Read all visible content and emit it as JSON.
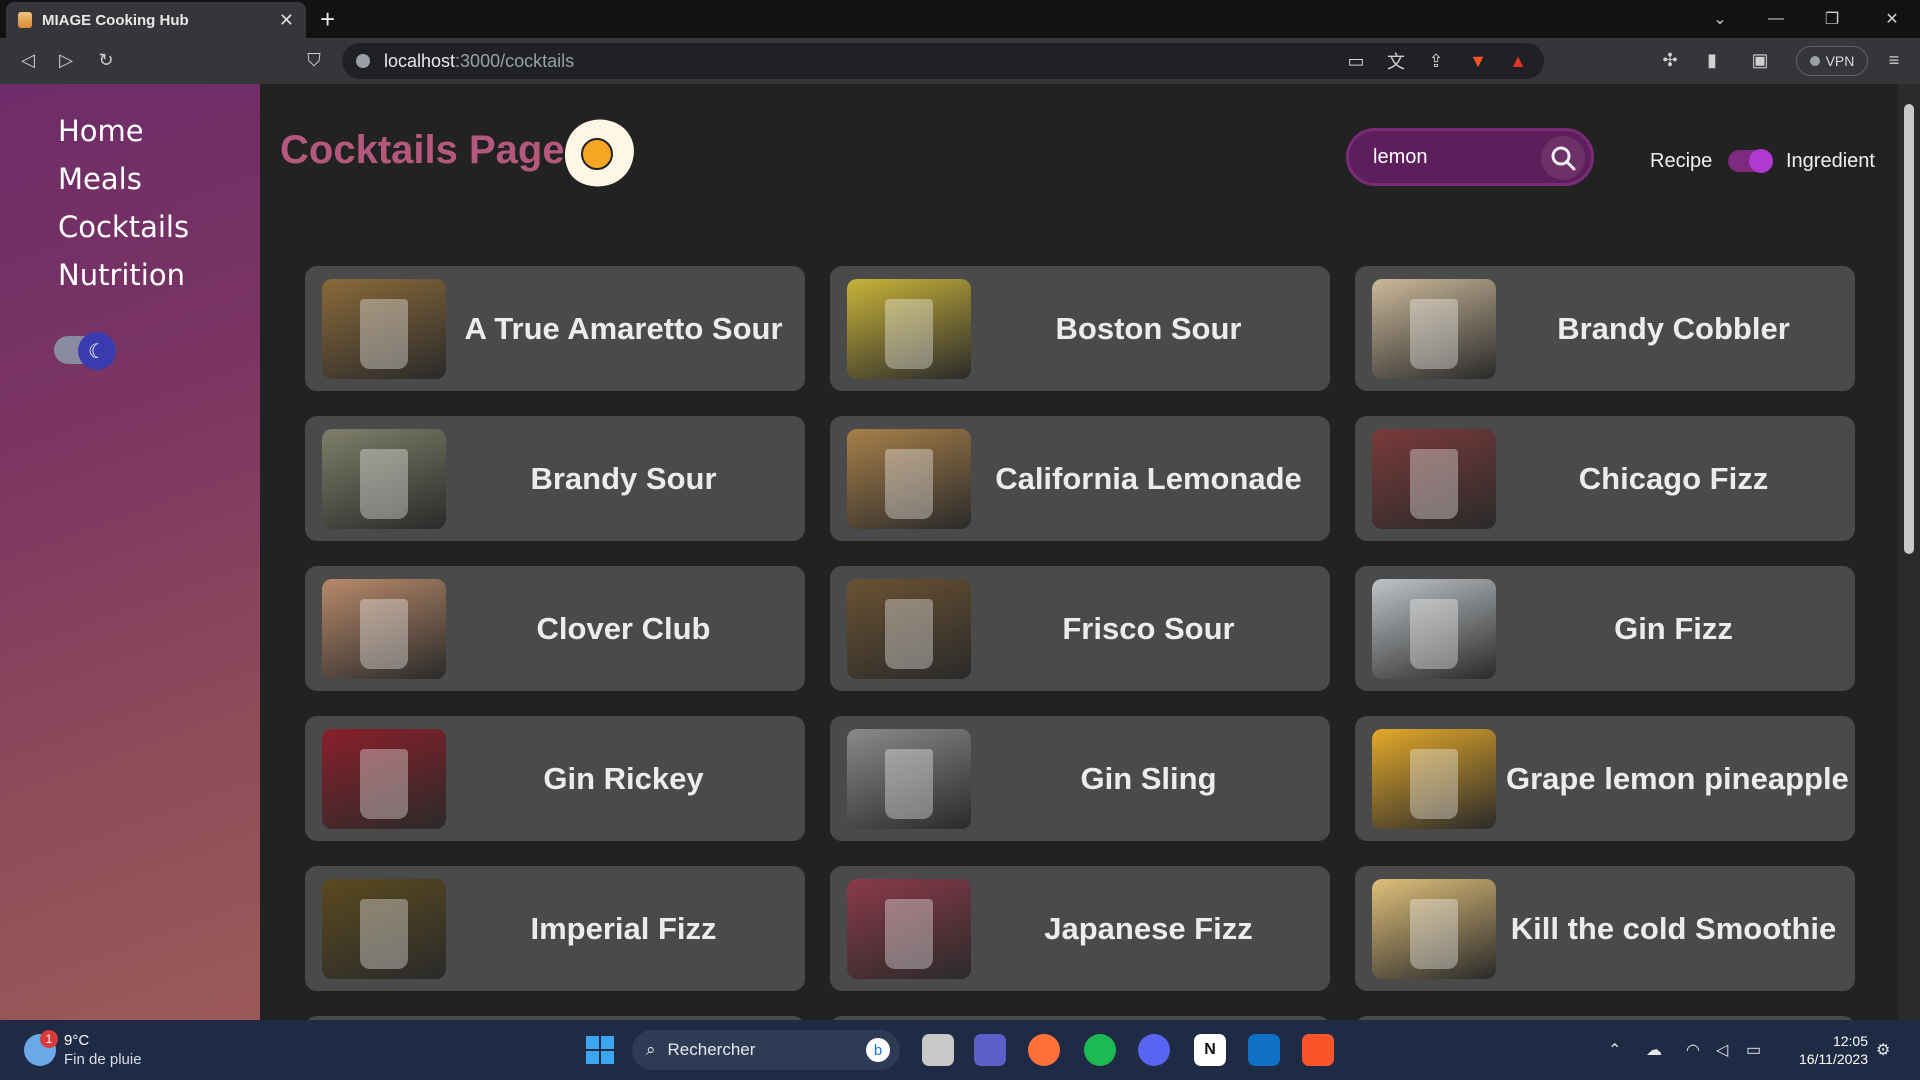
{
  "browser": {
    "tab_title": "MIAGE Cooking Hub",
    "tab_close": "✕",
    "new_tab": "+",
    "url_host": "localhost",
    "url_path": ":3000/cocktails",
    "vpn_label": "VPN"
  },
  "sidebar": {
    "items": [
      {
        "label": "Home"
      },
      {
        "label": "Meals"
      },
      {
        "label": "Cocktails"
      },
      {
        "label": "Nutrition"
      }
    ]
  },
  "header": {
    "title": "Cocktails Page",
    "search_value": "lemon",
    "mode_recipe": "Recipe",
    "mode_ingredient": "Ingredient"
  },
  "cocktails": [
    {
      "name": "A True Amaretto Sour",
      "color": "#8a6a3a"
    },
    {
      "name": "Boston Sour",
      "color": "#c9b43a"
    },
    {
      "name": "Brandy Cobbler",
      "color": "#cbb89a"
    },
    {
      "name": "Brandy Sour",
      "color": "#7f7f6a"
    },
    {
      "name": "California Lemonade",
      "color": "#a8804a"
    },
    {
      "name": "Chicago Fizz",
      "color": "#7a3a3a"
    },
    {
      "name": "Clover Club",
      "color": "#b88a6a"
    },
    {
      "name": "Frisco Sour",
      "color": "#6a5232"
    },
    {
      "name": "Gin Fizz",
      "color": "#bfc4c8"
    },
    {
      "name": "Gin Rickey",
      "color": "#8a1f2a"
    },
    {
      "name": "Gin Sling",
      "color": "#8a8a8a"
    },
    {
      "name": "Grape lemon pineapple",
      "color": "#e3a92a"
    },
    {
      "name": "Imperial Fizz",
      "color": "#5a4a1f"
    },
    {
      "name": "Japanese Fizz",
      "color": "#8a3a4a"
    },
    {
      "name": "Kill the cold Smoothie",
      "color": "#e0c07a"
    }
  ],
  "taskbar": {
    "weather_temp": "9°C",
    "weather_desc": "Fin de pluie",
    "weather_badge": "1",
    "search_label": "Rechercher",
    "time": "12:05",
    "date": "16/11/2023"
  }
}
